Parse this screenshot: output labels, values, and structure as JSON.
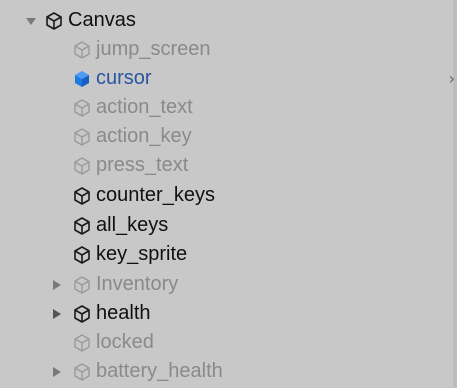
{
  "hierarchy": {
    "items": [
      {
        "label": "Canvas",
        "state": "active",
        "expander": "expanded-arrow-icon"
      },
      {
        "label": "jump_screen",
        "state": "inactive",
        "expander": ""
      },
      {
        "label": "cursor",
        "state": "selected",
        "expander": ""
      },
      {
        "label": "action_text",
        "state": "inactive",
        "expander": ""
      },
      {
        "label": "action_key",
        "state": "inactive",
        "expander": ""
      },
      {
        "label": "press_text",
        "state": "inactive",
        "expander": ""
      },
      {
        "label": "counter_keys",
        "state": "active",
        "expander": ""
      },
      {
        "label": "all_keys",
        "state": "active",
        "expander": ""
      },
      {
        "label": "key_sprite",
        "state": "active",
        "expander": ""
      },
      {
        "label": "Inventory",
        "state": "inactive",
        "expander": "collapsed-arrow-icon"
      },
      {
        "label": "health",
        "state": "active",
        "expander": "collapsed-arrow-icon"
      },
      {
        "label": "locked",
        "state": "inactive",
        "expander": ""
      },
      {
        "label": "battery_health",
        "state": "inactive",
        "expander": "collapsed-arrow-icon"
      }
    ]
  },
  "colors": {
    "panel_bg": "#c8c8c8",
    "text_active": "#101010",
    "text_inactive": "#8a8a8a",
    "text_selected": "#2a56a0",
    "cube_selected": "#1e78e6"
  },
  "icons": {
    "object": "game-object-cube-icon",
    "expanded": "expanded-arrow-icon",
    "collapsed": "collapsed-arrow-icon"
  },
  "side_hint": "›"
}
